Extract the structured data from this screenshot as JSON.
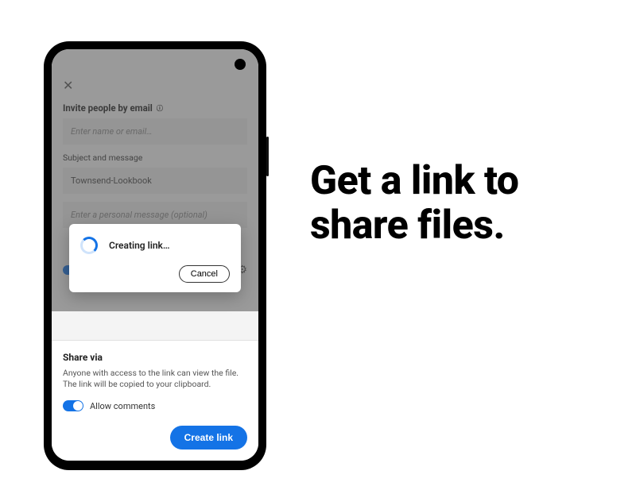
{
  "headline": "Get a link to share files.",
  "upper": {
    "invite_label": "Invite people by email",
    "name_placeholder": "Enter name or email…",
    "subject_label": "Subject and message",
    "subject_value": "Townsend-Lookbook",
    "message_placeholder": "Enter a personal message (optional)"
  },
  "modal": {
    "status": "Creating link…",
    "cancel": "Cancel"
  },
  "sheet": {
    "title": "Share via",
    "description": "Anyone with access to the link can view the file. The link will be copied to your clipboard.",
    "allow_label": "Allow comments",
    "create": "Create link"
  },
  "colors": {
    "accent": "#1473e6"
  }
}
